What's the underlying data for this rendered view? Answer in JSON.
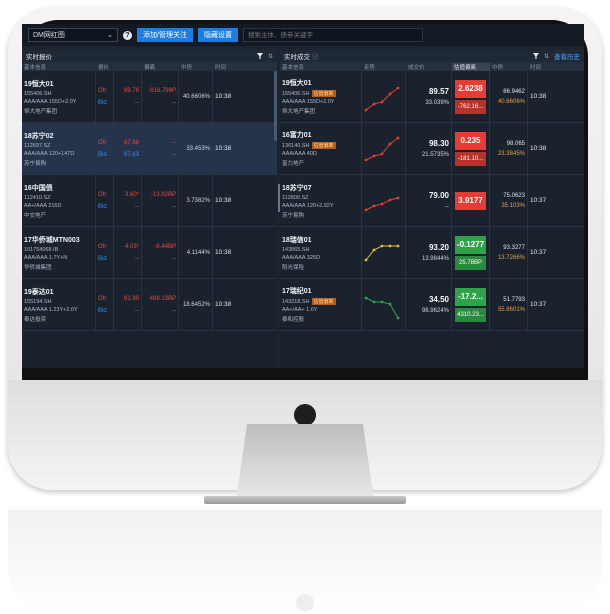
{
  "topbar": {
    "select_value": "DM网红图",
    "add_button": "添加/管理关注",
    "settings_button": "隐藏设置",
    "search_placeholder": "搜索主体、债券关键字"
  },
  "left_panel": {
    "title": "实时报价",
    "columns": [
      "基本信息",
      "报价",
      "",
      "偏离",
      "中债",
      "时间"
    ],
    "rows": [
      {
        "name": "19恒大01",
        "code": "155406.SH",
        "rating": "AAA/AAA  155D+2.0Y",
        "issuer": "恒大地产集团",
        "ofr": "Ofr",
        "ofr_price": "89.76",
        "dev": "-816.798P",
        "bid": "Bid",
        "bid_price": "--",
        "bid_dev": "--",
        "zz": "40.6606%",
        "time": "10:38"
      },
      {
        "name": "18苏宁02",
        "code": "112697.SZ",
        "rating": "AAA/AAA  120+147D",
        "issuer": "苏宁易购",
        "ofr": "Ofr",
        "ofr_price": "87.88",
        "dev": "--",
        "bid": "Bid",
        "bid_price": "87.63",
        "bid_dev": "--",
        "zz": "33.453%",
        "time": "10:38"
      },
      {
        "name": "16中国债",
        "code": "112410.SZ",
        "rating": "AA+/AAA  216D",
        "issuer": "中交地产",
        "ofr": "Ofr",
        "ofr_price": "3.60*",
        "dev": "-13.82BP",
        "bid": "Bid",
        "bid_price": "--",
        "bid_dev": "--",
        "zz": "3.7382%",
        "time": "10:38"
      },
      {
        "name": "17华侨城MTN003",
        "code": "101754068.IB",
        "rating": "AAA/AAA  1.7Y+N",
        "issuer": "华侨城集团",
        "ofr": "Ofr",
        "ofr_price": "4.03*",
        "dev": "-8.44BP",
        "bid": "Bid",
        "bid_price": "--",
        "bid_dev": "--",
        "zz": "4.1144%",
        "time": "10:38"
      },
      {
        "name": "19泰达01",
        "code": "155194.SH",
        "rating": "AAA/AAA  1.23Y+2.0Y",
        "issuer": "泰达投资",
        "ofr": "Ofr",
        "ofr_price": "81.99",
        "dev": "489.13BP",
        "bid": "Bid",
        "bid_price": "--",
        "bid_dev": "--",
        "zz": "18.6452%",
        "time": "10:38"
      }
    ]
  },
  "right_panel": {
    "title": "实时成交",
    "title_icon": "info-icon",
    "history_link": "查看历史",
    "columns": [
      "基本信息",
      "",
      "走势",
      "成交价",
      "估值偏离",
      "中债",
      "时间"
    ],
    "rows": [
      {
        "name": "19恒大01",
        "code": "155406.SH",
        "tag": "估值偏离",
        "rating": "AAA/AAA  155D+2.0Y",
        "issuer": "恒大地产集团",
        "price": "89.57",
        "pct": "33.039%",
        "badge": "2.6238",
        "badge_color": "r",
        "sub": "-762.16...",
        "sub_color": "r",
        "zz": "86.9462",
        "zz2": "40.6606%",
        "time": "10:38"
      },
      {
        "name": "16富力01",
        "code": "136140.SH",
        "tag": "估值偏离",
        "rating": "AAA/AAA  40D",
        "issuer": "富力地产",
        "price": "98.30",
        "pct": "21.5735%",
        "badge": "0.235",
        "badge_color": "r",
        "sub": "-181.10...",
        "sub_color": "r",
        "zz": "98.065",
        "zz2": "23.3845%",
        "time": "10:38"
      },
      {
        "name": "18苏宁07",
        "code": "112800.SZ",
        "tag": "",
        "rating": "AAA/AAA  120+2.92Y",
        "issuer": "苏宁易购",
        "price": "79.00",
        "pct": "--",
        "badge": "3.9177",
        "badge_color": "r",
        "sub": "",
        "sub_color": "",
        "zz": "75.0623",
        "zz2": "35.103%",
        "time": "10:37"
      },
      {
        "name": "18瑞信01",
        "code": "143865.SH",
        "tag": "",
        "rating": "AAA/AAA  325D",
        "issuer": "阳光保险",
        "price": "93.20",
        "pct": "13.9844%",
        "badge": "-0.1277",
        "badge_color": "g",
        "sub": "25.78BP",
        "sub_color": "g",
        "zz": "93.3277",
        "zz2": "13.7266%",
        "time": "10:37"
      },
      {
        "name": "17瑞纪01",
        "code": "143218.SH",
        "tag": "估值偏离",
        "rating": "AA+/AA+  1.6Y",
        "issuer": "泰和控股",
        "price": "34.50",
        "pct": "98.9624%",
        "badge": "-17.2...",
        "badge_color": "g",
        "sub": "4310.23...",
        "sub_color": "g",
        "zz": "51.7793",
        "zz2": "55.8601%",
        "time": "10:37"
      }
    ]
  }
}
